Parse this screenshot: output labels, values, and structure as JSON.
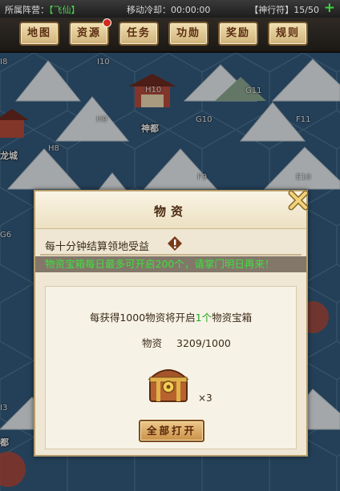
{
  "topbar": {
    "faction_label": "所属阵营：",
    "faction_value": "【飞仙】",
    "cooldown": "移动冷却：00:00:00",
    "token": "【神行符】15/50",
    "plus": "+"
  },
  "tabs": [
    "地图",
    "资源",
    "任务",
    "功勋",
    "奖励",
    "规则"
  ],
  "map": {
    "coords": [
      "I8",
      "I10",
      "H10",
      "G11",
      "H9",
      "G10",
      "F11",
      "H8",
      "F9",
      "E10",
      "G6",
      "I3"
    ],
    "cities": [
      "神都",
      "龙城",
      "都"
    ]
  },
  "dialog": {
    "title": "物资",
    "info": "每十分钟结算领地受益",
    "marquee": "物资宝箱每日最多可开启200个，请掌门明日再来！",
    "line1_prefix": "每获得1000物资将开启",
    "line1_count": "1个",
    "line1_suffix": "物资宝箱",
    "supply_label": "物资",
    "supply_value": "3209/1000",
    "chest_count": "×3",
    "open_all": "全部打开"
  },
  "colors": {
    "accent_green": "#3fe03f",
    "title_brown": "#4a2a12",
    "button_gold": "#c99048"
  }
}
